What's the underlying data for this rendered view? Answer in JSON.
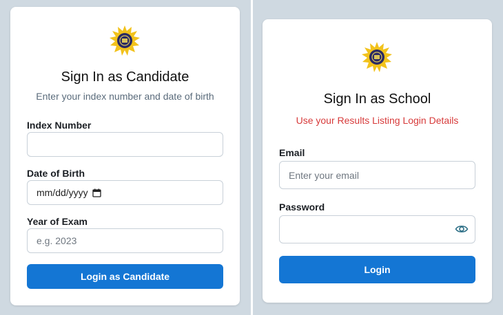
{
  "candidate": {
    "title": "Sign In as Candidate",
    "subtitle": "Enter your index number and date of birth",
    "index_label": "Index Number",
    "index_value": "",
    "dob_label": "Date of Birth",
    "dob_value": "mm/dd/yyyy",
    "year_label": "Year of Exam",
    "year_placeholder": "e.g. 2023",
    "login_button": "Login as Candidate"
  },
  "school": {
    "title": "Sign In as School",
    "subtitle": "Use your Results Listing Login Details",
    "email_label": "Email",
    "email_placeholder": "Enter your email",
    "password_label": "Password",
    "password_value": "",
    "login_button": "Login"
  },
  "colors": {
    "background": "#cfd9e1",
    "primary": "#1476d4",
    "subtitle_red": "#d73a3a",
    "subtitle_muted": "#5a6b7b"
  },
  "icons": [
    "logo-emblem-icon",
    "calendar-icon",
    "eye-icon"
  ]
}
